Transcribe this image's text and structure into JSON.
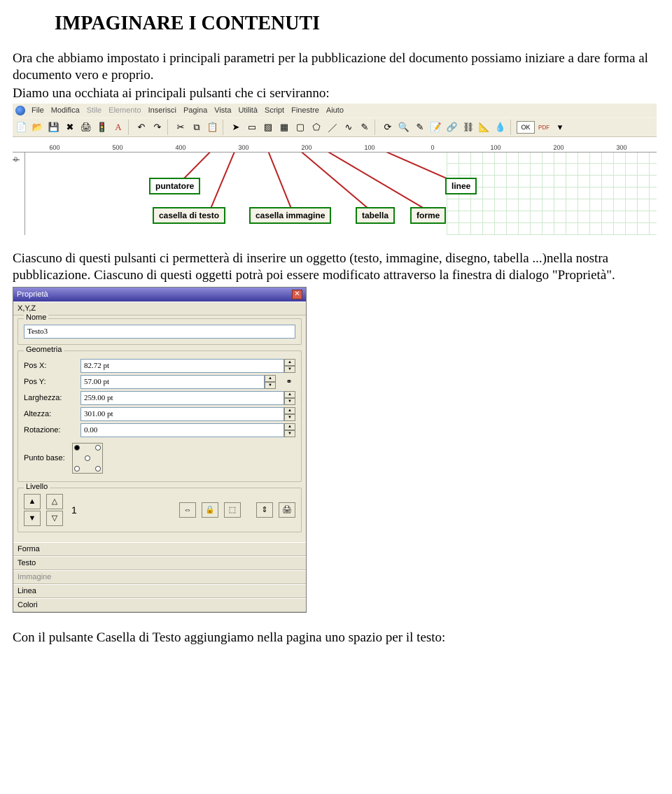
{
  "heading": "IMPAGINARE I CONTENUTI",
  "intro": {
    "p1": "Ora che abbiamo impostato i principali parametri per la pubblicazione del documento possiamo iniziare a dare forma al documento vero e proprio.",
    "p2": "Diamo una occhiata ai principali pulsanti che ci serviranno:"
  },
  "menubar": {
    "items": [
      "File",
      "Modifica",
      "Stile",
      "Elemento",
      "Inserisci",
      "Pagina",
      "Vista",
      "Utilità",
      "Script",
      "Finestre",
      "Aiuto"
    ]
  },
  "toolbar": {
    "ok_label": "OK",
    "pdf_label": "PDF"
  },
  "ruler": {
    "ticks": [
      "600",
      "500",
      "400",
      "300",
      "200",
      "100",
      "0",
      "100",
      "200",
      "300"
    ]
  },
  "vruler": {
    "zero": "0"
  },
  "callouts": {
    "puntatore": "puntatore",
    "casella_testo": "casella di testo",
    "casella_immagine": "casella immagine",
    "tabella": "tabella",
    "linee": "linee",
    "forme": "forme"
  },
  "mid": {
    "p1": "Ciascuno di questi pulsanti ci permetterà di inserire un oggetto (testo, immagine, disegno, tabella ...)nella nostra pubblicazione. Ciascuno di questi oggetti potrà poi essere modificato attraverso la finestra di dialogo \"Proprietà\"."
  },
  "properties": {
    "title": "Proprietà",
    "sections": {
      "xyz": "X,Y,Z",
      "nome": "Nome",
      "geometria": "Geometria",
      "livello": "Livello",
      "forma": "Forma",
      "testo": "Testo",
      "immagine": "Immagine",
      "linea": "Linea",
      "colori": "Colori"
    },
    "name_value": "Testo3",
    "geom": {
      "posx_label": "Pos X:",
      "posy_label": "Pos Y:",
      "larg_label": "Larghezza:",
      "alt_label": "Altezza:",
      "rot_label": "Rotazione:",
      "posx": "82.72 pt",
      "posy": "57.00 pt",
      "larghezza": "259.00 pt",
      "altezza": "301.00 pt",
      "rotazione": "0.00"
    },
    "basepoint_label": "Punto base:",
    "level_value": "1"
  },
  "bottom": "Con il pulsante Casella di Testo aggiungiamo nella pagina uno spazio per il testo:"
}
